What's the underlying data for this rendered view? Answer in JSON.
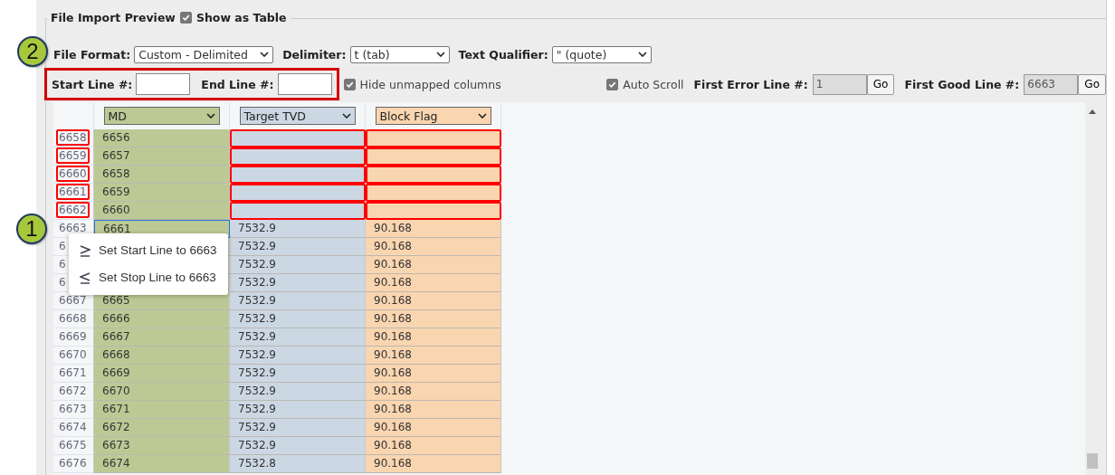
{
  "legend": {
    "title": "File Import Preview",
    "show_as_table": {
      "label": "Show as Table",
      "checked": true
    }
  },
  "badges": [
    "2",
    "1"
  ],
  "format_row": [
    {
      "label": "File Format:",
      "value": "Custom - Delimited"
    },
    {
      "label": "Delimiter:",
      "value": "t (tab)"
    },
    {
      "label": "Text Qualifier:",
      "value": "\" (quote)"
    }
  ],
  "line_range": {
    "start_label": "Start Line #:",
    "end_label": "End Line #:",
    "highlighted": true
  },
  "hide_unmapped": {
    "label": "Hide unmapped columns",
    "checked": true
  },
  "auto_scroll": {
    "label": "Auto Scroll",
    "checked": true
  },
  "first_error": {
    "label": "First Error Line #:",
    "value": "1",
    "button": "Go"
  },
  "first_good": {
    "label": "First Good Line #:",
    "value": "6663",
    "button": "Go"
  },
  "columns": [
    {
      "label": "MD",
      "color": "#bdc995"
    },
    {
      "label": "Target TVD",
      "color": "#ccd7e4"
    },
    {
      "label": "Block Flag",
      "color": "#f9d5b0"
    }
  ],
  "rows": [
    {
      "line": "6658",
      "md": "6656",
      "error": true,
      "selected": false
    },
    {
      "line": "6659",
      "md": "6657",
      "error": true,
      "selected": false
    },
    {
      "line": "6660",
      "md": "6658",
      "error": true,
      "selected": false
    },
    {
      "line": "6661",
      "md": "6659",
      "error": true,
      "selected": false
    },
    {
      "line": "6662",
      "md": "6660",
      "error": true,
      "selected": false
    },
    {
      "line": "6663",
      "md": "6661",
      "tvd": "7532.9",
      "flag": "90.168",
      "error": false,
      "selected": true
    },
    {
      "line": "6",
      "tvd": "7532.9",
      "flag": "90.168",
      "error": false,
      "selected": false
    },
    {
      "line": "6",
      "tvd": "7532.9",
      "flag": "90.168",
      "error": false,
      "selected": false
    },
    {
      "line": "6",
      "tvd": "7532.9",
      "flag": "90.168",
      "error": false,
      "selected": false
    },
    {
      "line": "6667",
      "md": "6665",
      "tvd": "7532.9",
      "flag": "90.168",
      "error": false,
      "selected": false
    },
    {
      "line": "6668",
      "md": "6666",
      "tvd": "7532.9",
      "flag": "90.168",
      "error": false,
      "selected": false
    },
    {
      "line": "6669",
      "md": "6667",
      "tvd": "7532.9",
      "flag": "90.168",
      "error": false,
      "selected": false
    },
    {
      "line": "6670",
      "md": "6668",
      "tvd": "7532.9",
      "flag": "90.168",
      "error": false,
      "selected": false
    },
    {
      "line": "6671",
      "md": "6669",
      "tvd": "7532.9",
      "flag": "90.168",
      "error": false,
      "selected": false
    },
    {
      "line": "6672",
      "md": "6670",
      "tvd": "7532.9",
      "flag": "90.168",
      "error": false,
      "selected": false
    },
    {
      "line": "6673",
      "md": "6671",
      "tvd": "7532.9",
      "flag": "90.168",
      "error": false,
      "selected": false
    },
    {
      "line": "6674",
      "md": "6672",
      "tvd": "7532.9",
      "flag": "90.168",
      "error": false,
      "selected": false
    },
    {
      "line": "6675",
      "md": "6673",
      "tvd": "7532.9",
      "flag": "90.168",
      "error": false,
      "selected": false
    },
    {
      "line": "6676",
      "md": "6674",
      "tvd": "7532.8",
      "flag": "90.168",
      "error": false,
      "selected": false
    }
  ],
  "context_menu": [
    {
      "kind": "start",
      "label": "Set Start Line to 6663"
    },
    {
      "kind": "stop",
      "label": "Set Stop Line to 6663"
    }
  ]
}
